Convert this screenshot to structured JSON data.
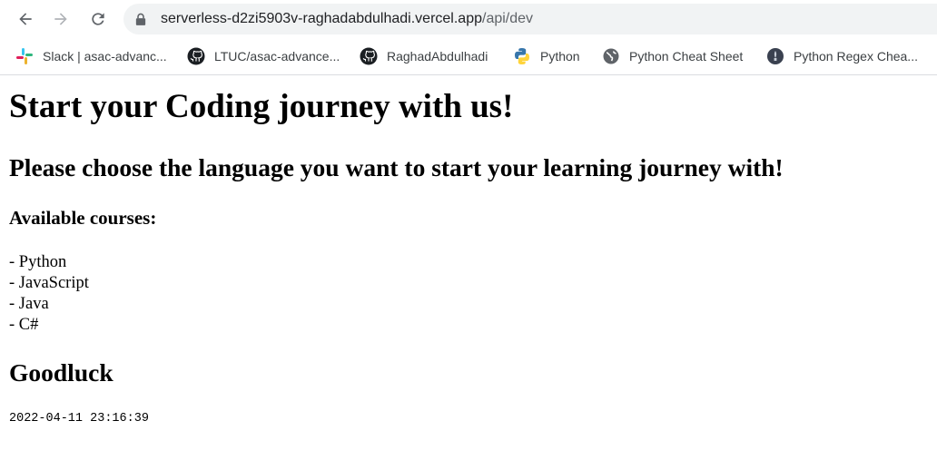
{
  "browser": {
    "url_host": "serverless-d2zi5903v-raghadabdulhadi.vercel.app",
    "url_path": "/api/dev",
    "bookmarks": [
      {
        "label": "Slack | asac-advanc...",
        "icon": "slack-icon"
      },
      {
        "label": "LTUC/asac-advance...",
        "icon": "github-icon"
      },
      {
        "label": "RaghadAbdulhadi",
        "icon": "github-icon"
      },
      {
        "label": "Python",
        "icon": "python-icon"
      },
      {
        "label": "Python Cheat Sheet",
        "icon": "globe-icon"
      },
      {
        "label": "Python Regex Chea...",
        "icon": "site-icon"
      }
    ]
  },
  "page": {
    "title": "Start your Coding journey with us!",
    "subtitle": "Please choose the language you want to start your learning journey with!",
    "courses_heading": "Available courses:",
    "courses": [
      "- Python",
      "- JavaScript",
      "- Java",
      "- C#"
    ],
    "closing": "Goodluck",
    "timestamp": "2022-04-11 23:16:39"
  },
  "colors": {
    "omnibox_bg": "#f1f3f4",
    "chrome_icon": "#5f6368",
    "text": "#000000"
  }
}
